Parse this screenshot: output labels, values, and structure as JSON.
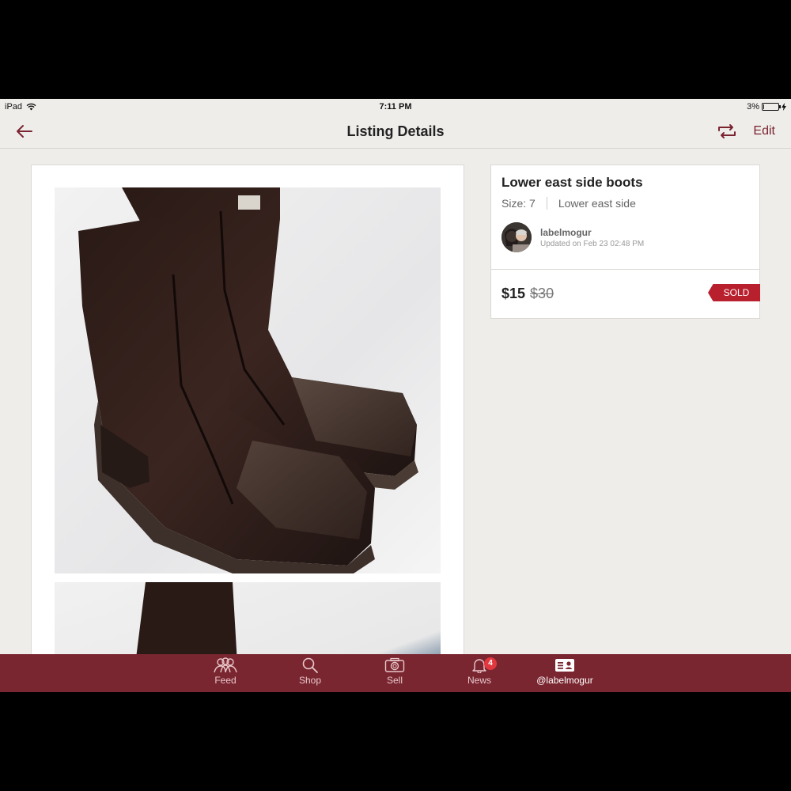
{
  "status_bar": {
    "device": "iPad",
    "time": "7:11 PM",
    "battery": "3%",
    "battery_level": 0.03
  },
  "nav": {
    "title": "Listing Details",
    "edit_label": "Edit"
  },
  "listing": {
    "title": "Lower east side boots",
    "size_label": "Size: 7",
    "brand": "Lower east side",
    "seller_name": "labelmogur",
    "updated": "Updated on Feb 23 02:48 PM",
    "price": "$15",
    "original_price": "$30",
    "status": "SOLD"
  },
  "tabs": [
    {
      "label": "Feed",
      "icon": "people-icon"
    },
    {
      "label": "Shop",
      "icon": "search-icon"
    },
    {
      "label": "Sell",
      "icon": "camera-icon"
    },
    {
      "label": "News",
      "icon": "bell-icon",
      "badge": "4"
    },
    {
      "label": "@labelmogur",
      "icon": "profile-card-icon"
    }
  ],
  "colors": {
    "accent": "#7a2630",
    "sold": "#b8202e",
    "background": "#efedea"
  }
}
